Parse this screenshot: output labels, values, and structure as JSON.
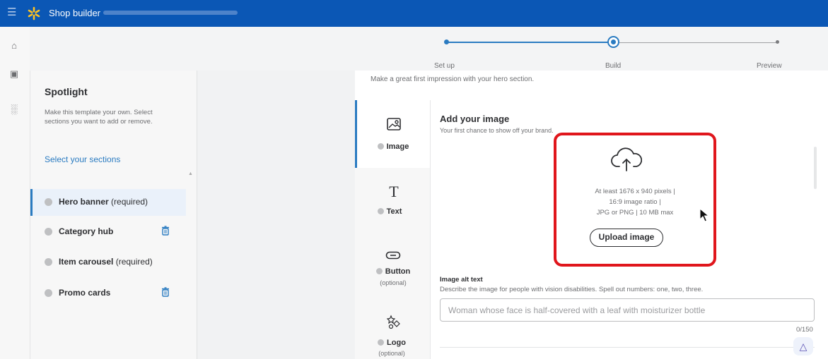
{
  "app": {
    "title": "Shop builder"
  },
  "stepper": {
    "steps": [
      "Set up",
      "Build",
      "Preview"
    ],
    "active_index": 1
  },
  "spotlight": {
    "title": "Spotlight",
    "description": "Make this template your own. Select sections you want to add or remove.",
    "select_link": "Select your sections",
    "sections": [
      {
        "name": "Hero banner",
        "suffix": "(required)",
        "removable": false,
        "active": true
      },
      {
        "name": "Category hub",
        "suffix": "",
        "removable": true,
        "active": false
      },
      {
        "name": "Item carousel",
        "suffix": "(required)",
        "removable": false,
        "active": false
      },
      {
        "name": "Promo cards",
        "suffix": "",
        "removable": true,
        "active": false
      }
    ]
  },
  "builder": {
    "intro": "Make a great first impression with your hero section.",
    "tabs": [
      {
        "label": "Image",
        "sub": "",
        "icon": "image-icon"
      },
      {
        "label": "Text",
        "sub": "",
        "icon": "text-icon"
      },
      {
        "label": "Button",
        "sub": "(optional)",
        "icon": "button-icon"
      },
      {
        "label": "Logo",
        "sub": "(optional)",
        "icon": "logo-icon"
      }
    ],
    "image": {
      "title": "Add your image",
      "subtitle": "Your first chance to show off your brand.",
      "req_line1": "At least 1676 x 940 pixels |",
      "req_line2": "16:9 image ratio |",
      "req_line3": "JPG or PNG | 10 MB max",
      "upload_label": "Upload image"
    },
    "alt_text": {
      "title": "Image alt text",
      "description": "Describe the image for people with vision disabilities. Spell out numbers: one, two, three.",
      "placeholder": "Woman whose face is half-covered with a leaf with moisturizer bottle",
      "counter": "0/150"
    }
  },
  "colors": {
    "brand": "#0b57b5",
    "accent": "#2a7bc1",
    "highlight": "#e0161c"
  }
}
